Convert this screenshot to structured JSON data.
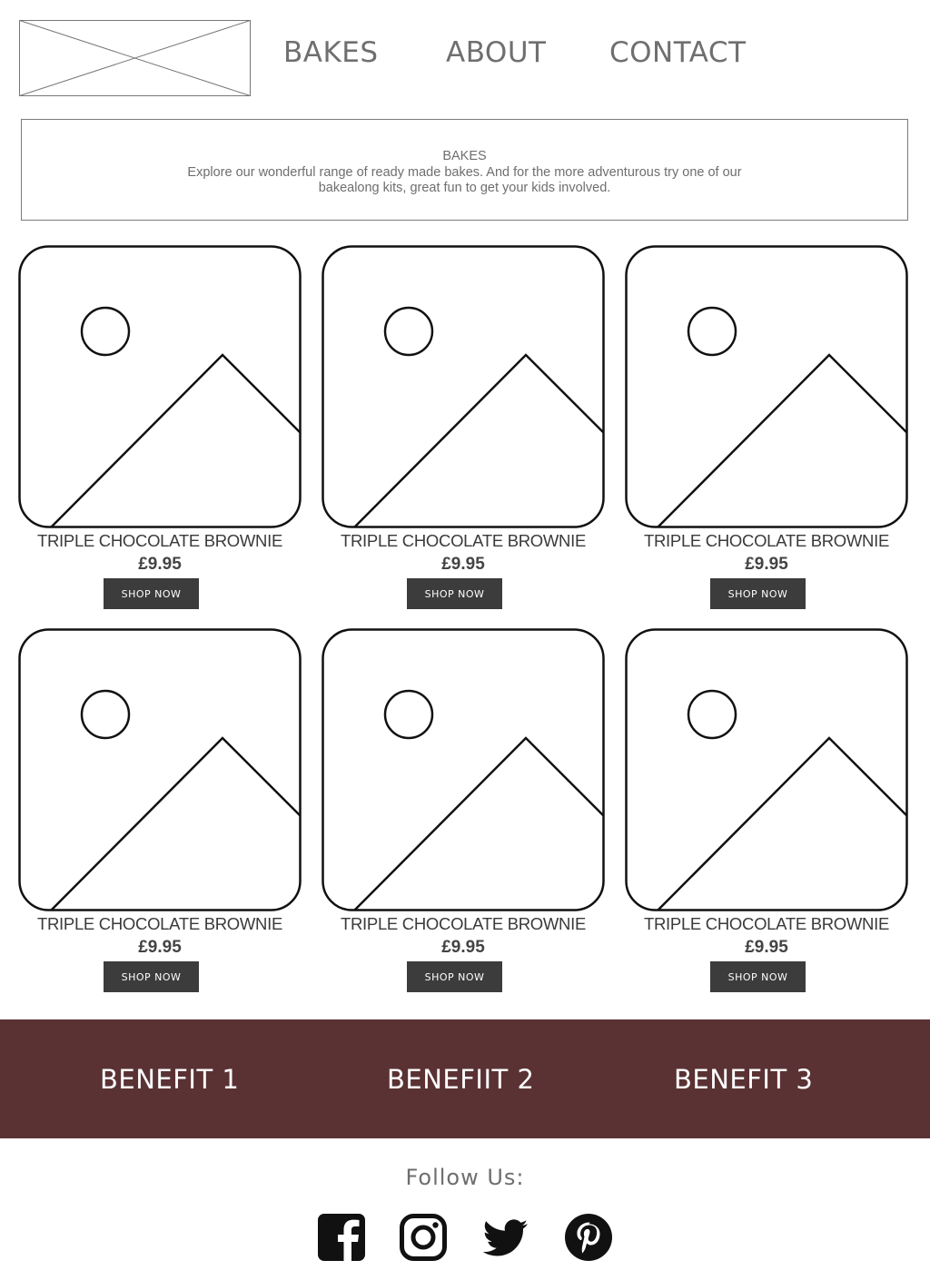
{
  "nav": {
    "items": [
      "BAKES",
      "ABOUT",
      "CONTACT"
    ]
  },
  "intro": {
    "heading": "BAKES",
    "body": "Explore our wonderful range of ready made bakes. And for the more adventurous try one of our bakealong kits, great fun to get your kids involved."
  },
  "products": [
    {
      "name": "TRIPLE CHOCOLATE BROWNIE",
      "price": "£9.95",
      "button": "SHOP NOW"
    },
    {
      "name": "TRIPLE CHOCOLATE BROWNIE",
      "price": "£9.95",
      "button": "SHOP NOW"
    },
    {
      "name": "TRIPLE CHOCOLATE BROWNIE",
      "price": "£9.95",
      "button": "SHOP NOW"
    },
    {
      "name": "TRIPLE CHOCOLATE BROWNIE",
      "price": "£9.95",
      "button": "SHOP NOW"
    },
    {
      "name": "TRIPLE CHOCOLATE BROWNIE",
      "price": "£9.95",
      "button": "SHOP NOW"
    },
    {
      "name": "TRIPLE CHOCOLATE BROWNIE",
      "price": "£9.95",
      "button": "SHOP NOW"
    }
  ],
  "benefits": [
    "BENEFIT 1",
    "BENEFIIT 2",
    "BENEFIT 3"
  ],
  "footer": {
    "follow_label": "Follow Us:",
    "social_icons": [
      "facebook-icon",
      "instagram-icon",
      "twitter-icon",
      "pinterest-icon"
    ]
  },
  "colors": {
    "band": "#5a3234",
    "button": "#3c3c3c",
    "text": "#6e6e6e"
  }
}
